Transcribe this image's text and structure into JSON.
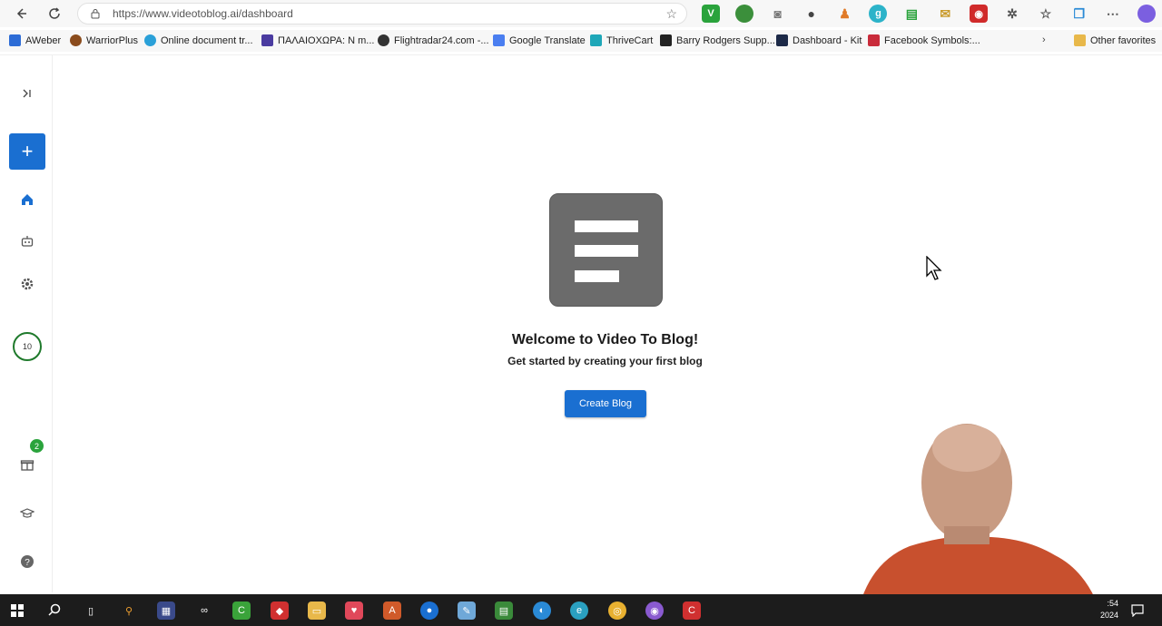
{
  "browser": {
    "url": "https://www.videotoblog.ai/dashboard",
    "bookmarks": [
      {
        "label": "AWeber",
        "color": "#2d6cd6"
      },
      {
        "label": "WarriorPlus",
        "color": "#8a4b1c"
      },
      {
        "label": "Online document tr...",
        "color": "#2aa0d8"
      },
      {
        "label": "ΠΑΛΑΙΟΧΩΡΑ: N m...",
        "color": "#4a3ba0"
      },
      {
        "label": "Flightradar24.com -...",
        "color": "#333333"
      },
      {
        "label": "Google Translate",
        "color": "#4a7ef0"
      },
      {
        "label": "ThriveCart",
        "color": "#1ea7b8"
      },
      {
        "label": "Barry Rodgers Supp...",
        "color": "#222222"
      },
      {
        "label": "Dashboard - Kit",
        "color": "#1d2a48"
      },
      {
        "label": "Facebook Symbols:...",
        "color": "#c92b3a"
      }
    ],
    "other_favorites": "Other favorites"
  },
  "sidebar": {
    "credits": "10",
    "gift_badge": "2"
  },
  "main": {
    "welcome": "Welcome to Video To Blog!",
    "subtitle": "Get started by creating your first blog",
    "create_button": "Create Blog"
  },
  "taskbar": {
    "time": ":54",
    "date": "2024"
  },
  "colors": {
    "accent": "#1a6fd1",
    "credit_ring": "#1f7a2c",
    "badge": "#2aa33c",
    "icon_tile": "#6b6b6b"
  }
}
